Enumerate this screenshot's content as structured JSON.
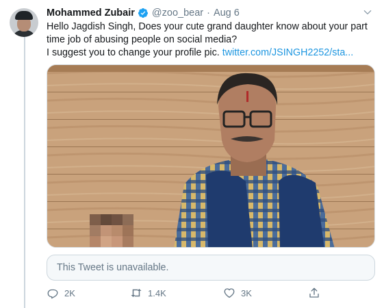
{
  "tweet": {
    "author_name": "Mohammed Zubair",
    "handle": "@zoo_bear",
    "separator": "·",
    "date": "Aug 6",
    "text_line1": "Hello Jagdish Singh, Does your cute grand daughter know about your part",
    "text_line2": "time job of abusing people on social media?",
    "text_line3": "I suggest you to change your profile pic.",
    "link_text": "twitter.com/JSINGH2252/sta...",
    "quoted_notice": "This Tweet is unavailable.",
    "actions": {
      "reply_count": "2K",
      "retweet_count": "1.4K",
      "like_count": "3K"
    }
  },
  "icons": {
    "verified": "verified-badge-icon",
    "caret": "chevron-down-icon",
    "reply": "reply-icon",
    "retweet": "retweet-icon",
    "like": "heart-icon",
    "share": "share-icon"
  },
  "colors": {
    "verified_badge": "#1da1f2",
    "link": "#1b95e0",
    "secondary_text": "#657786",
    "thread_line": "#ccd6dd"
  }
}
